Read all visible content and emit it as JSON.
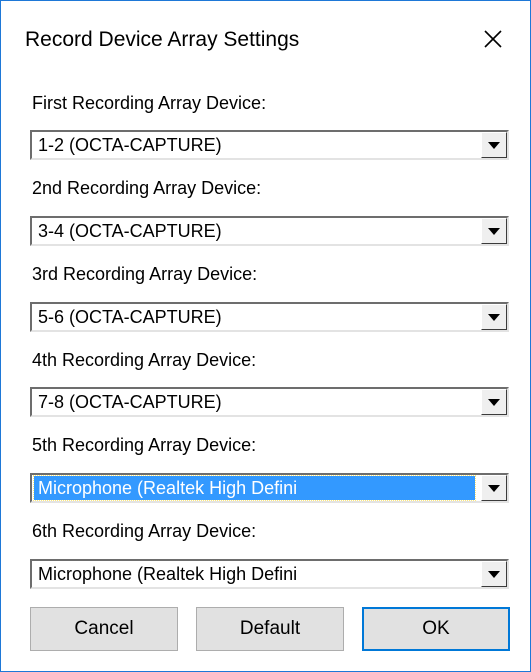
{
  "window": {
    "title": "Record Device Array Settings"
  },
  "fields": [
    {
      "label": "First Recording Array Device:",
      "value": "1-2 (OCTA-CAPTURE)"
    },
    {
      "label": "2nd Recording Array Device:",
      "value": "3-4 (OCTA-CAPTURE)"
    },
    {
      "label": "3rd Recording Array Device:",
      "value": "5-6 (OCTA-CAPTURE)"
    },
    {
      "label": "4th Recording Array Device:",
      "value": "7-8 (OCTA-CAPTURE)"
    },
    {
      "label": "5th Recording Array Device:",
      "value": "Microphone (Realtek High Defini",
      "focused": true
    },
    {
      "label": "6th Recording Array Device:",
      "value": "Microphone (Realtek High Defini"
    }
  ],
  "buttons": {
    "cancel": "Cancel",
    "default": "Default",
    "ok": "OK"
  },
  "colors": {
    "window_border": "#1e78d7",
    "selection": "#3399ff",
    "button_face": "#e1e1e1",
    "default_button_border": "#0078d7"
  },
  "icons": {
    "close": "close-icon",
    "dropdown": "dropdown-arrow-icon"
  }
}
